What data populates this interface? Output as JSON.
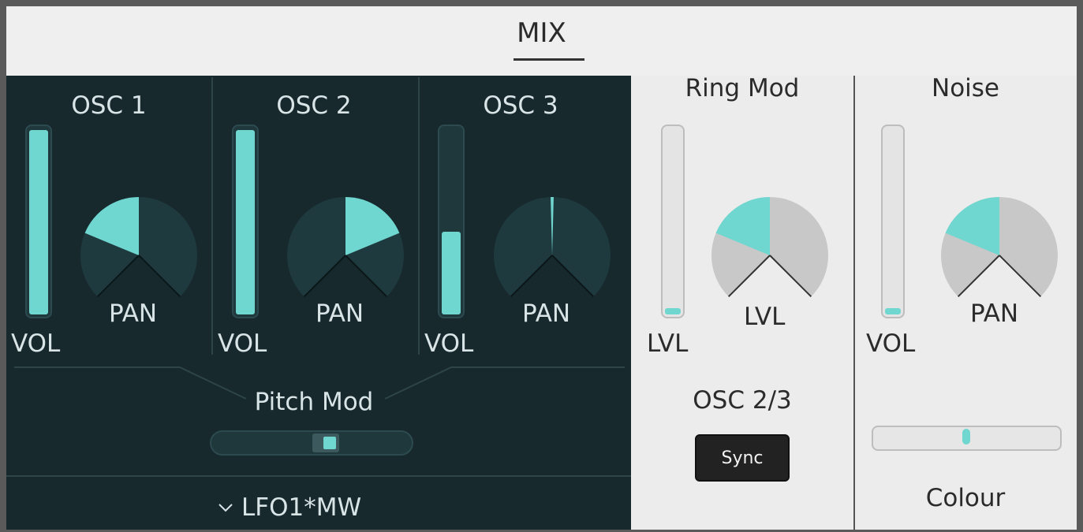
{
  "panel": {
    "title": "MIX"
  },
  "oscillators": [
    {
      "title": "OSC 1",
      "vol_label": "VOL",
      "pan_label": "PAN",
      "vol_level": 1.0,
      "pan_value": -0.5
    },
    {
      "title": "OSC 2",
      "vol_label": "VOL",
      "pan_label": "PAN",
      "vol_level": 1.0,
      "pan_value": 0.5
    },
    {
      "title": "OSC 3",
      "vol_label": "VOL",
      "pan_label": "PAN",
      "vol_level": 0.45,
      "pan_value": 0.0
    }
  ],
  "pitch_mod": {
    "label": "Pitch Mod",
    "value": 0.6,
    "source_label": "LFO1*MW",
    "source_icon": "chevron-down-icon"
  },
  "ring_mod": {
    "title": "Ring Mod",
    "lvl_label": "LVL",
    "knob_label": "LVL",
    "level": 0.0,
    "knob_value": -0.5,
    "osc_label": "OSC 2/3",
    "sync_label": "Sync"
  },
  "noise": {
    "title": "Noise",
    "vol_label": "VOL",
    "pan_label": "PAN",
    "vol_level": 0.0,
    "pan_value": -0.5,
    "colour_label": "Colour",
    "colour_value": 0.5
  },
  "colors": {
    "accent": "#6fd6d0",
    "dark_bg": "#17292d",
    "light_bg": "#ececec"
  }
}
